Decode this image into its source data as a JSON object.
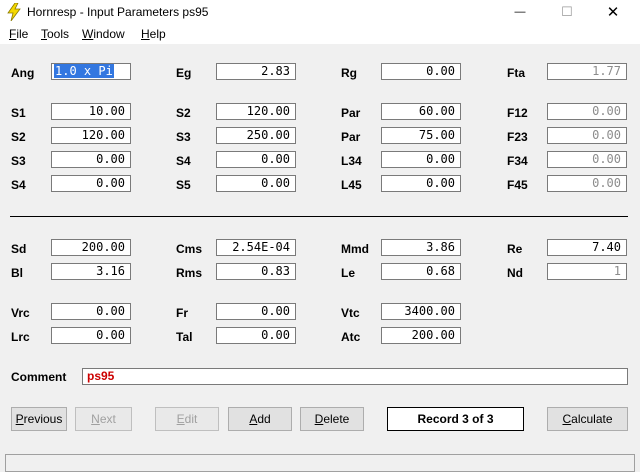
{
  "window": {
    "title": "Hornresp - Input Parameters   ps95",
    "minimize_glyph": "—",
    "maximize_glyph": "☐",
    "close_glyph": "✕"
  },
  "menu": [
    {
      "first": "F",
      "rest": "ile"
    },
    {
      "first": "T",
      "rest": "ools"
    },
    {
      "first": "W",
      "rest": "indow"
    },
    {
      "first": "H",
      "rest": "elp"
    }
  ],
  "labels": {
    "ang": "Ang",
    "eg": "Eg",
    "rg": "Rg",
    "fta": "Fta",
    "s1": "S1",
    "s2a": "S2",
    "par1": "Par",
    "f12": "F12",
    "s2b": "S2",
    "s3a": "S3",
    "par2": "Par",
    "f23": "F23",
    "s3b": "S3",
    "s4a": "S4",
    "l34": "L34",
    "f34": "F34",
    "s4b": "S4",
    "s5": "S5",
    "l45": "L45",
    "f45": "F45",
    "sd": "Sd",
    "cms": "Cms",
    "mmd": "Mmd",
    "re": "Re",
    "bl": "Bl",
    "rms": "Rms",
    "le": "Le",
    "nd": "Nd",
    "vrc": "Vrc",
    "fr": "Fr",
    "vtc": "Vtc",
    "lrc": "Lrc",
    "tal": "Tal",
    "atc": "Atc",
    "comment": "Comment"
  },
  "values": {
    "ang": "1.0 x Pi",
    "eg": "2.83",
    "rg": "0.00",
    "fta": "1.77",
    "s1": "10.00",
    "s2a": "120.00",
    "par1": "60.00",
    "f12": "0.00",
    "s2b": "120.00",
    "s3a": "250.00",
    "par2": "75.00",
    "f23": "0.00",
    "s3b": "0.00",
    "s4a": "0.00",
    "l34": "0.00",
    "f34": "0.00",
    "s4b": "0.00",
    "s5": "0.00",
    "l45": "0.00",
    "f45": "0.00",
    "sd": "200.00",
    "cms": "2.54E-04",
    "mmd": "3.86",
    "re": "7.40",
    "bl": "3.16",
    "rms": "0.83",
    "le": "0.68",
    "nd": "1",
    "vrc": "0.00",
    "fr": "0.00",
    "vtc": "3400.00",
    "lrc": "0.00",
    "tal": "0.00",
    "atc": "200.00",
    "comment": "ps95"
  },
  "buttons": {
    "previous": {
      "first": "P",
      "rest": "revious"
    },
    "next": {
      "first": "N",
      "rest": "ext"
    },
    "edit": {
      "first": "E",
      "rest": "dit"
    },
    "add": {
      "first": "A",
      "rest": "dd"
    },
    "delete": {
      "first": "D",
      "rest": "elete"
    },
    "calculate": {
      "first": "C",
      "rest": "alculate"
    }
  },
  "record_status": "Record 3 of 3"
}
